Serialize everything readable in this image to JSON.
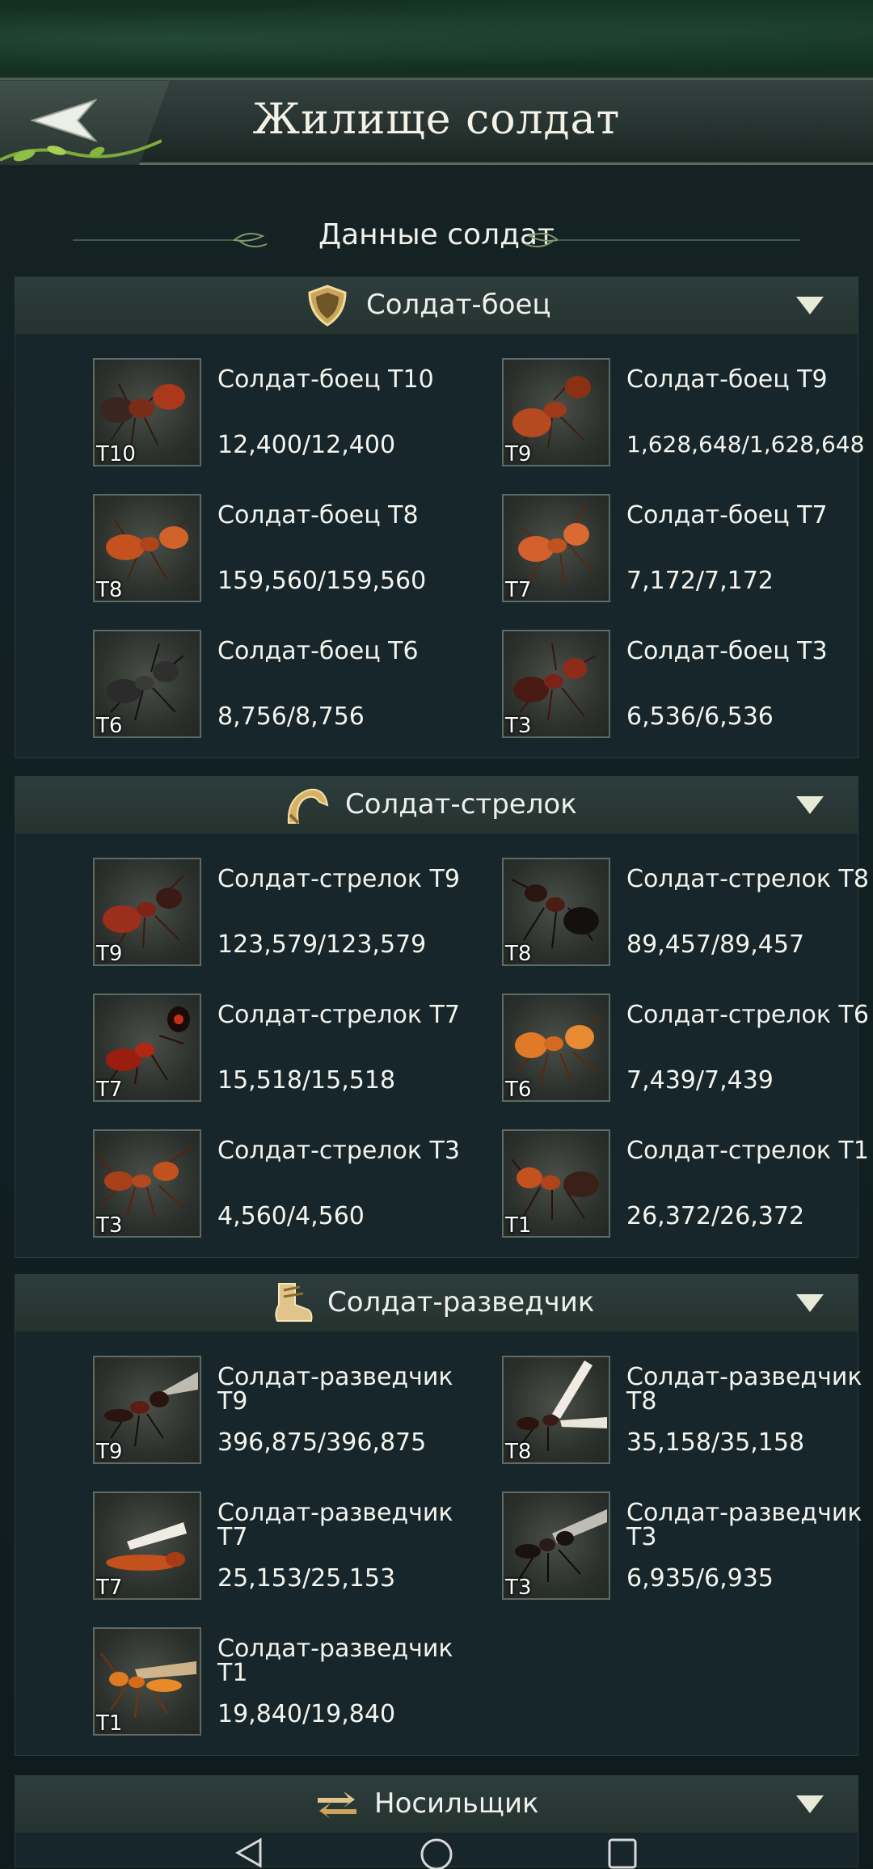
{
  "header": {
    "title": "Жилище солдат"
  },
  "subtitle": "Данные солдат",
  "sections": [
    {
      "label": "Солдат-боец",
      "units": [
        {
          "name": "Солдат-боец Т10",
          "count": "12,400/12,400",
          "tier": "T10"
        },
        {
          "name": "Солдат-боец Т9",
          "count": "1,628,648/1,628,648",
          "tier": "T9"
        },
        {
          "name": "Солдат-боец Т8",
          "count": "159,560/159,560",
          "tier": "T8"
        },
        {
          "name": "Солдат-боец Т7",
          "count": "7,172/7,172",
          "tier": "T7"
        },
        {
          "name": "Солдат-боец Т6",
          "count": "8,756/8,756",
          "tier": "T6"
        },
        {
          "name": "Солдат-боец Т3",
          "count": "6,536/6,536",
          "tier": "T3"
        }
      ]
    },
    {
      "label": "Солдат-стрелок",
      "units": [
        {
          "name": "Солдат-стрелок Т9",
          "count": "123,579/123,579",
          "tier": "T9"
        },
        {
          "name": "Солдат-стрелок Т8",
          "count": "89,457/89,457",
          "tier": "T8"
        },
        {
          "name": "Солдат-стрелок Т7",
          "count": "15,518/15,518",
          "tier": "T7"
        },
        {
          "name": "Солдат-стрелок Т6",
          "count": "7,439/7,439",
          "tier": "T6"
        },
        {
          "name": "Солдат-стрелок Т3",
          "count": "4,560/4,560",
          "tier": "T3"
        },
        {
          "name": "Солдат-стрелок Т1",
          "count": "26,372/26,372",
          "tier": "T1"
        }
      ]
    },
    {
      "label": "Солдат-разведчик",
      "units": [
        {
          "name": "Солдат-разведчик Т9",
          "count": "396,875/396,875",
          "tier": "T9"
        },
        {
          "name": "Солдат-разведчик Т8",
          "count": "35,158/35,158",
          "tier": "T8"
        },
        {
          "name": "Солдат-разведчик Т7",
          "count": "25,153/25,153",
          "tier": "T7"
        },
        {
          "name": "Солдат-разведчик Т3",
          "count": "6,935/6,935",
          "tier": "T3"
        },
        {
          "name": "Солдат-разведчик Т1",
          "count": "19,840/19,840",
          "tier": "T1"
        }
      ]
    },
    {
      "label": "Носильщик",
      "units": []
    }
  ]
}
